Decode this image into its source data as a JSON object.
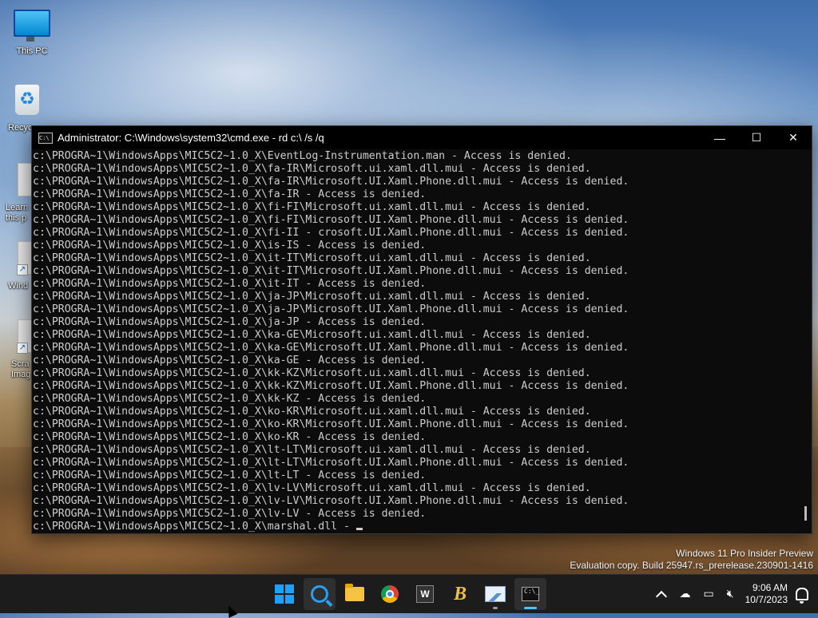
{
  "desktop": {
    "icons": [
      {
        "label": "This PC",
        "icon": "this-pc-icon"
      },
      {
        "label": "Recyc",
        "icon": "recycle-bin-icon"
      },
      {
        "label": "Learn\nthis p",
        "icon": "learn-shortcut-icon"
      },
      {
        "label": "Wind",
        "icon": "windows-shortcut-icon"
      },
      {
        "label": "Scra\nImag",
        "icon": "scratch-image-shortcut-icon"
      }
    ]
  },
  "window": {
    "title": "Administrator: C:\\Windows\\system32\\cmd.exe - rd  c:\\ /s /q",
    "icon_text": "C:\\",
    "minimize": "—",
    "maximize": "☐",
    "close": "✕"
  },
  "console": {
    "lines": [
      "c:\\PROGRA~1\\WindowsApps\\MIC5C2~1.0_X\\EventLog-Instrumentation.man - Access is denied.",
      "c:\\PROGRA~1\\WindowsApps\\MIC5C2~1.0_X\\fa-IR\\Microsoft.ui.xaml.dll.mui - Access is denied.",
      "c:\\PROGRA~1\\WindowsApps\\MIC5C2~1.0_X\\fa-IR\\Microsoft.UI.Xaml.Phone.dll.mui - Access is denied.",
      "c:\\PROGRA~1\\WindowsApps\\MIC5C2~1.0_X\\fa-IR - Access is denied.",
      "c:\\PROGRA~1\\WindowsApps\\MIC5C2~1.0_X\\fi-FI\\Microsoft.ui.xaml.dll.mui - Access is denied.",
      "c:\\PROGRA~1\\WindowsApps\\MIC5C2~1.0_X\\fi-FI\\Microsoft.UI.Xaml.Phone.dll.mui - Access is denied.",
      "c:\\PROGRA~1\\WindowsApps\\MIC5C2~1.0_X\\fi-II - crosoft.UI.Xaml.Phone.dll.mui - Access is denied.",
      "c:\\PROGRA~1\\WindowsApps\\MIC5C2~1.0_X\\is-IS - Access is denied.",
      "c:\\PROGRA~1\\WindowsApps\\MIC5C2~1.0_X\\it-IT\\Microsoft.ui.xaml.dll.mui - Access is denied.",
      "c:\\PROGRA~1\\WindowsApps\\MIC5C2~1.0_X\\it-IT\\Microsoft.UI.Xaml.Phone.dll.mui - Access is denied.",
      "c:\\PROGRA~1\\WindowsApps\\MIC5C2~1.0_X\\it-IT - Access is denied.",
      "c:\\PROGRA~1\\WindowsApps\\MIC5C2~1.0_X\\ja-JP\\Microsoft.ui.xaml.dll.mui - Access is denied.",
      "c:\\PROGRA~1\\WindowsApps\\MIC5C2~1.0_X\\ja-JP\\Microsoft.UI.Xaml.Phone.dll.mui - Access is denied.",
      "c:\\PROGRA~1\\WindowsApps\\MIC5C2~1.0_X\\ja-JP - Access is denied.",
      "c:\\PROGRA~1\\WindowsApps\\MIC5C2~1.0_X\\ka-GE\\Microsoft.ui.xaml.dll.mui - Access is denied.",
      "c:\\PROGRA~1\\WindowsApps\\MIC5C2~1.0_X\\ka-GE\\Microsoft.UI.Xaml.Phone.dll.mui - Access is denied.",
      "c:\\PROGRA~1\\WindowsApps\\MIC5C2~1.0_X\\ka-GE - Access is denied.",
      "c:\\PROGRA~1\\WindowsApps\\MIC5C2~1.0_X\\kk-KZ\\Microsoft.ui.xaml.dll.mui - Access is denied.",
      "c:\\PROGRA~1\\WindowsApps\\MIC5C2~1.0_X\\kk-KZ\\Microsoft.UI.Xaml.Phone.dll.mui - Access is denied.",
      "c:\\PROGRA~1\\WindowsApps\\MIC5C2~1.0_X\\kk-KZ - Access is denied.",
      "c:\\PROGRA~1\\WindowsApps\\MIC5C2~1.0_X\\ko-KR\\Microsoft.ui.xaml.dll.mui - Access is denied.",
      "c:\\PROGRA~1\\WindowsApps\\MIC5C2~1.0_X\\ko-KR\\Microsoft.UI.Xaml.Phone.dll.mui - Access is denied.",
      "c:\\PROGRA~1\\WindowsApps\\MIC5C2~1.0_X\\ko-KR - Access is denied.",
      "c:\\PROGRA~1\\WindowsApps\\MIC5C2~1.0_X\\lt-LT\\Microsoft.ui.xaml.dll.mui - Access is denied.",
      "c:\\PROGRA~1\\WindowsApps\\MIC5C2~1.0_X\\lt-LT\\Microsoft.UI.Xaml.Phone.dll.mui - Access is denied.",
      "c:\\PROGRA~1\\WindowsApps\\MIC5C2~1.0_X\\lt-LT - Access is denied.",
      "c:\\PROGRA~1\\WindowsApps\\MIC5C2~1.0_X\\lv-LV\\Microsoft.ui.xaml.dll.mui - Access is denied.",
      "c:\\PROGRA~1\\WindowsApps\\MIC5C2~1.0_X\\lv-LV\\Microsoft.UI.Xaml.Phone.dll.mui - Access is denied.",
      "c:\\PROGRA~1\\WindowsApps\\MIC5C2~1.0_X\\lv-LV - Access is denied."
    ],
    "current_line": "c:\\PROGRA~1\\WindowsApps\\MIC5C2~1.0_X\\marshal.dll -"
  },
  "watermark": {
    "line1": "Windows 11 Pro Insider Preview",
    "line2": "Evaluation copy. Build 25947.rs_prerelease.230901-1416"
  },
  "taskbar": {
    "apps": [
      {
        "name": "start-button",
        "icon": "windows-logo-icon"
      },
      {
        "name": "search-button",
        "icon": "search-icon"
      },
      {
        "name": "file-explorer-button",
        "icon": "folder-icon"
      },
      {
        "name": "chrome-button",
        "icon": "chrome-icon"
      },
      {
        "name": "w-app-button",
        "icon": "w-app-icon",
        "text": "W"
      },
      {
        "name": "b-app-button",
        "icon": "b-app-icon",
        "text": "B"
      },
      {
        "name": "photo-app-button",
        "icon": "image-chart-icon"
      },
      {
        "name": "terminal-button",
        "icon": "terminal-icon",
        "text": "C:\\_"
      }
    ],
    "tray": {
      "time": "9:06 AM",
      "date": "10/7/2023"
    }
  }
}
